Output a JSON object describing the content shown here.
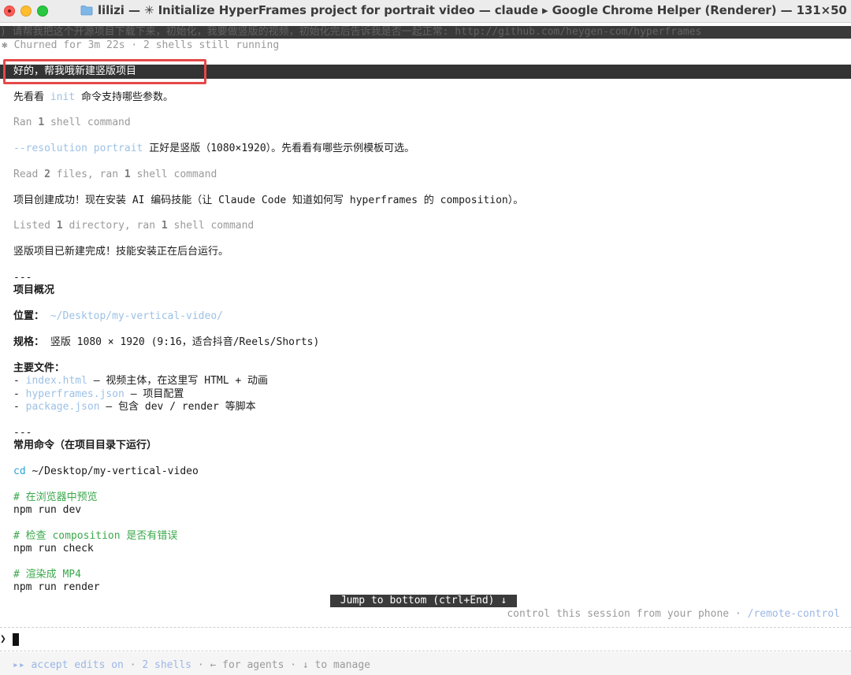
{
  "window": {
    "title": "lilizi — ✳ Initialize HyperFrames project for portrait video — claude ▸ Google Chrome Helper (Renderer) — 131×50"
  },
  "header": {
    "previous_prompt": ") 请帮我把这个开源项目下载下来，初始化，我要做竖版的视频，初始化完后告诉我是否一起正常: http://github.com/heygen-com/hyperframes",
    "churned": "✱ Churned for 3m 22s · 2 shells still running"
  },
  "user_message": "好的，帮我哦新建竖版项目",
  "transcript": {
    "l1_prefix": "先看看 ",
    "l1_code": "init",
    "l1_suffix": " 命令支持哪些参数。",
    "l2_a": "Ran ",
    "l2_n": "1",
    "l2_b": " shell command",
    "l3_code": "--resolution portrait",
    "l3_text": " 正好是竖版（1080×1920）。先看看有哪些示例模板可选。",
    "l4_a": "Read ",
    "l4_n1": "2",
    "l4_b": " files, ran ",
    "l4_n2": "1",
    "l4_c": " shell command",
    "l5": "项目创建成功！现在安装 AI 编码技能（让 Claude Code 知道如何写 hyperframes 的 composition）。",
    "l6_a": "Listed ",
    "l6_n1": "1",
    "l6_b": " directory, ran ",
    "l6_n2": "1",
    "l6_c": " shell command",
    "l7": "竖版项目已新建完成！技能安装正在后台运行。",
    "rule1": "---",
    "overview_heading": "项目概况",
    "location_label": "位置：",
    "location_value": " ~/Desktop/my-vertical-video/",
    "spec_label": "规格：",
    "spec_value": " 竖版 1080 × 1920 (9:16，适合抖音/Reels/Shorts)",
    "files_heading": "主要文件：",
    "file1_dash": "- ",
    "file1_name": "index.html",
    "file1_desc": " — 视频主体，在这里写 HTML + 动画",
    "file2_dash": "- ",
    "file2_name": "hyperframes.json",
    "file2_desc": " — 项目配置",
    "file3_dash": "- ",
    "file3_name": "package.json",
    "file3_desc": " — 包含 dev / render 等脚本",
    "rule2": "---",
    "commands_heading": "常用命令（在项目目录下运行）",
    "cd_kw": "cd",
    "cd_path": " ~/Desktop/my-vertical-video",
    "c1_comment": "# 在浏览器中预览",
    "c1_cmd": "npm run dev",
    "c2_comment": "# 检查 composition 是否有错误",
    "c2_cmd": "npm run check",
    "c3_comment": "# 渲染成 MP4",
    "c3_cmd": "npm run render"
  },
  "jump_to_bottom": "Jump to bottom (ctrl+End) ↓",
  "remote": {
    "text": "control this session from your phone · ",
    "link": "/remote-control"
  },
  "prompt_symbol": "❯",
  "status": {
    "mode_icon": "▸▸",
    "mode": " accept edits on",
    "sep1": " · ",
    "shells": "2 shells",
    "sep2": " · ",
    "agents": "← for agents",
    "sep3": " · ",
    "manage": "↓ to manage"
  },
  "colors": {
    "accent_blue": "#9cc1e6",
    "comment_green": "#3aa84a",
    "highlight_red": "#e54848"
  }
}
